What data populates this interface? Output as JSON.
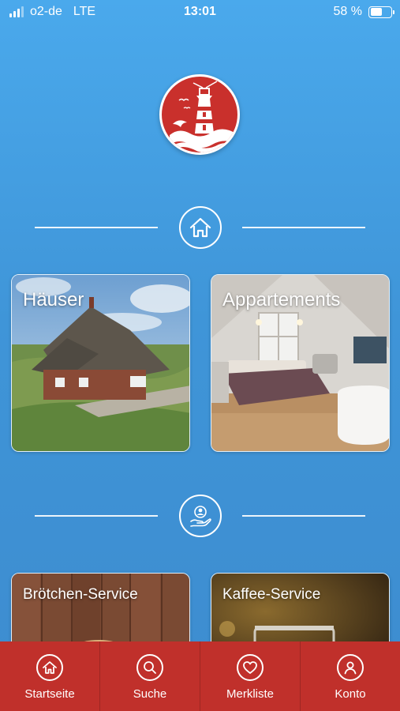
{
  "status_bar": {
    "carrier": "o2-de",
    "network": "LTE",
    "time": "13:01",
    "battery_percent_label": "58 %",
    "battery_level": 0.58
  },
  "logo": {
    "icon": "lighthouse-logo"
  },
  "sections": {
    "houses_section": {
      "icon": "house-icon"
    },
    "service_section": {
      "icon": "hand-person-icon"
    }
  },
  "cards": {
    "haeuser": {
      "title": "Häuser"
    },
    "appartements": {
      "title": "Appartements"
    },
    "broetchen": {
      "title": "Brötchen-Service"
    },
    "kaffee": {
      "title": "Kaffee-Service"
    }
  },
  "tab_bar": {
    "items": [
      {
        "label": "Startseite",
        "icon": "home-icon"
      },
      {
        "label": "Suche",
        "icon": "search-icon"
      },
      {
        "label": "Merkliste",
        "icon": "heart-icon"
      },
      {
        "label": "Konto",
        "icon": "user-icon"
      }
    ],
    "background": "#c0302b"
  },
  "colors": {
    "background_top": "#4aa9ec",
    "background_bottom": "#3d8ccf",
    "accent_red": "#c9302c"
  }
}
